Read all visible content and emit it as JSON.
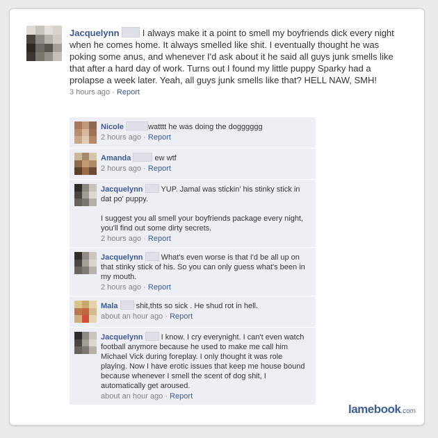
{
  "post": {
    "name": "Jacquelynn",
    "text": "I always make it a point to smell my boyfriends dick every night when he comes home. It always smelled like shit. I eventually thought he was poking some anus, and whenever I'd ask about it he said all guys junk smells like that after a hard day of work. Turns out I found my little puppy Sparky had a prolapse a week later. Yeah, all guys junk smells like that? HELL NAW, SMH!",
    "time": "3 hours ago",
    "separator": "·",
    "report": "Report"
  },
  "comments": [
    {
      "name": "Nicole",
      "text": "watttt he was doing the dogggggg",
      "time": "2 hours ago",
      "report": "Report"
    },
    {
      "name": "Amanda",
      "text": "ew wtf",
      "time": "2 hours ago",
      "report": "Report"
    },
    {
      "name": "Jacquelynn",
      "text": "YUP. Jamal was stickin' his stinky stick in dat po' puppy.",
      "text2": "I suggest you all smell your boyfriends package every night, you'll find out some dirty secrets.",
      "time": "2 hours ago",
      "report": "Report"
    },
    {
      "name": "Jacquelynn",
      "text": "What's even worse is that I'd be all up on that stinky stick of his. So you can only guess what's been in my mouth.",
      "time": "2 hours ago",
      "report": "Report"
    },
    {
      "name": "Mala",
      "text": "shit,thts so sick . He shud rot in hell.",
      "time": "about an hour ago",
      "report": "Report"
    },
    {
      "name": "Jacquelynn",
      "text": "I know. I cry everynight. I can't even watch football anymore because he used to make me call him Michael Vick during foreplay. I only thought it was role playing. Now I have erotic issues that keep me house bound because whenever I smell the scent of dog shit, I automatically get aroused.",
      "time": "about an hour ago",
      "report": "Report"
    }
  ],
  "watermark": {
    "brand": "lamebook",
    "tld": ".com"
  }
}
